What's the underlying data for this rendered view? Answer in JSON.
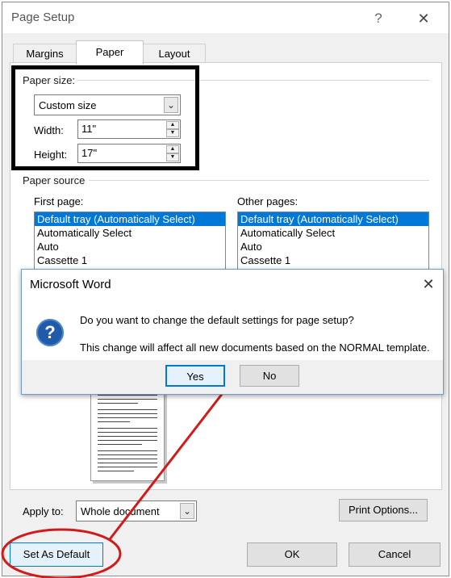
{
  "window": {
    "title": "Page Setup",
    "help_label": "?",
    "close_label": "✕"
  },
  "tabs": [
    {
      "label": "Margins",
      "active": false
    },
    {
      "label": "Paper",
      "active": true
    },
    {
      "label": "Layout",
      "active": false
    }
  ],
  "paper_size": {
    "group_label": "Paper size:",
    "selected": "Custom size",
    "width_label": "Width:",
    "width_value": "11\"",
    "height_label": "Height:",
    "height_value": "17\""
  },
  "paper_source": {
    "group_label": "Paper source",
    "first_page_label": "First page:",
    "other_pages_label": "Other pages:",
    "first_page_items": [
      "Default tray (Automatically Select)",
      "Automatically Select",
      "Auto",
      "Cassette 1"
    ],
    "other_pages_items": [
      "Default tray (Automatically Select)",
      "Automatically Select",
      "Auto",
      "Cassette 1"
    ]
  },
  "apply_to": {
    "label": "Apply to:",
    "selected": "Whole document"
  },
  "buttons": {
    "print_options": "Print Options...",
    "set_as_default": "Set As Default",
    "ok": "OK",
    "cancel": "Cancel"
  },
  "message_box": {
    "title": "Microsoft Word",
    "close_label": "✕",
    "icon": "question-icon",
    "question": "Do you want to change the default settings for page setup?",
    "detail": "This change will affect all new documents based on the NORMAL template.",
    "yes_label": "Yes",
    "no_label": "No"
  },
  "annotations": {
    "highlight_color": "#d11a1a",
    "box_color": "#000000",
    "selection_color": "#0078d7"
  }
}
